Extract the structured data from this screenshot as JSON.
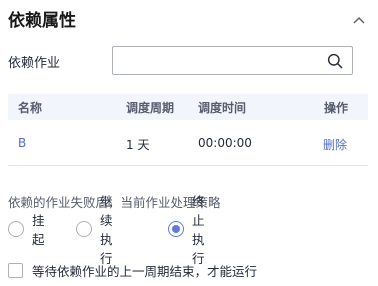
{
  "section": {
    "title": "依赖属性",
    "collapse_icon": "chevron-up-icon"
  },
  "dependency": {
    "label": "依赖作业",
    "input_value": "",
    "input_placeholder": "",
    "search_icon": "search-icon"
  },
  "table": {
    "columns": [
      "名称",
      "调度周期",
      "调度时间",
      "操作"
    ],
    "rows": [
      {
        "name": "B",
        "period": "1 天",
        "time": "00:00:00",
        "action": "删除"
      }
    ]
  },
  "strategy": {
    "label": "依赖的作业失败后，当前作业处理策略",
    "options": [
      "挂起",
      "继续执行",
      "终止执行"
    ],
    "selected": "终止执行"
  },
  "wait_option": {
    "label": "等待依赖作业的上一周期结束，才能运行",
    "checked": false
  },
  "colors": {
    "accent": "#5e7ce0",
    "link": "#526ecc",
    "header_bg": "#f2f5fc"
  }
}
